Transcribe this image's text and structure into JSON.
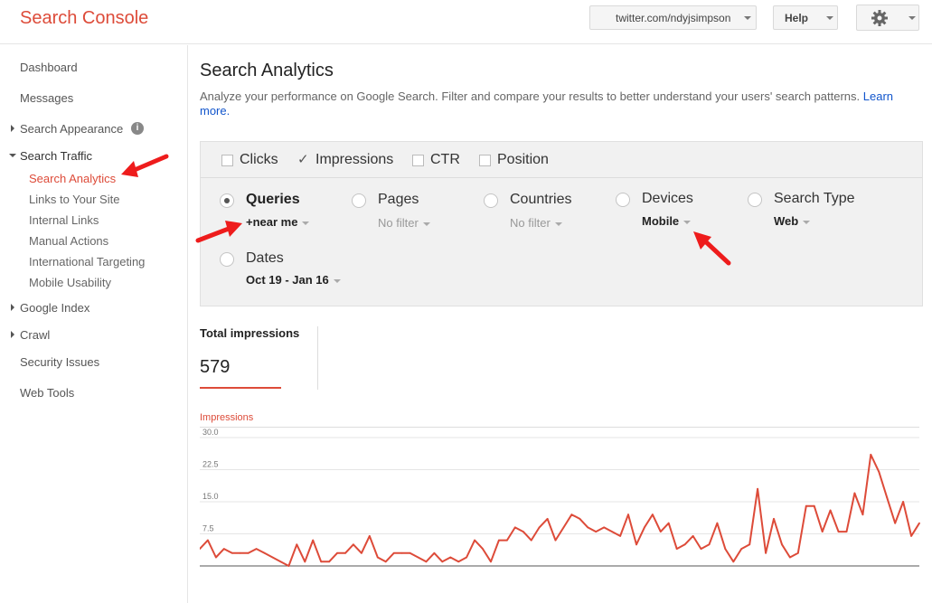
{
  "app": {
    "title": "Search Console",
    "site_selector": "twitter.com/ndyjsimpson",
    "help_label": "Help",
    "brand_color": "#dd4b39"
  },
  "sidebar": {
    "items": [
      {
        "label": "Dashboard"
      },
      {
        "label": "Messages"
      },
      {
        "label": "Search Appearance",
        "info_icon": "i"
      },
      {
        "label": "Search Traffic",
        "expanded": true
      },
      {
        "label": "Google Index"
      },
      {
        "label": "Crawl"
      },
      {
        "label": "Security Issues"
      },
      {
        "label": "Web Tools"
      }
    ],
    "search_traffic_children": [
      {
        "label": "Search Analytics",
        "active": true
      },
      {
        "label": "Links to Your Site"
      },
      {
        "label": "Internal Links"
      },
      {
        "label": "Manual Actions"
      },
      {
        "label": "International Targeting"
      },
      {
        "label": "Mobile Usability"
      }
    ]
  },
  "main": {
    "title": "Search Analytics",
    "description": "Analyze your performance on Google Search. Filter and compare your results to better understand your users' search patterns.",
    "learn_more": "Learn more.",
    "metrics": [
      {
        "label": "Clicks",
        "checked": false
      },
      {
        "label": "Impressions",
        "checked": true
      },
      {
        "label": "CTR",
        "checked": false
      },
      {
        "label": "Position",
        "checked": false
      }
    ],
    "dimensions": [
      {
        "label": "Queries",
        "filter": "+near me",
        "selected": true
      },
      {
        "label": "Pages",
        "filter": "No filter",
        "selected": false
      },
      {
        "label": "Countries",
        "filter": "No filter",
        "selected": false
      },
      {
        "label": "Devices",
        "filter": "Mobile",
        "selected": false
      },
      {
        "label": "Search Type",
        "filter": "Web",
        "selected": false
      },
      {
        "label": "Dates",
        "filter": "Oct 19 - Jan 16",
        "selected": false
      }
    ],
    "totals": {
      "label": "Total impressions",
      "value": "579"
    }
  },
  "chart_data": {
    "type": "line",
    "title": "Impressions",
    "ylim": [
      0,
      30
    ],
    "yticks": [
      "30.0",
      "22.5",
      "15.0",
      "7.5"
    ],
    "grid": true,
    "color": "#dd4b39",
    "series": [
      {
        "values": [
          4,
          6,
          2,
          4,
          3,
          3,
          3,
          4,
          3,
          2,
          1,
          0,
          5,
          1,
          6,
          1,
          1,
          3,
          3,
          5,
          3,
          7,
          2,
          1,
          3,
          3,
          3,
          2,
          1,
          3,
          1,
          2,
          1,
          2,
          6,
          4,
          1,
          6,
          6,
          9,
          8,
          6,
          9,
          11,
          6,
          9,
          12,
          11,
          9,
          8,
          9,
          8,
          7,
          12,
          5,
          9,
          12,
          8,
          10,
          4,
          5,
          7,
          4,
          5,
          10,
          4,
          1,
          4,
          5,
          18,
          3,
          11,
          5,
          2,
          3,
          14,
          14,
          8,
          13,
          8,
          8,
          17,
          12,
          26,
          22,
          16,
          10,
          15,
          7,
          10
        ]
      }
    ]
  },
  "annotations": {
    "arrow_color": "#ee1c1c"
  }
}
